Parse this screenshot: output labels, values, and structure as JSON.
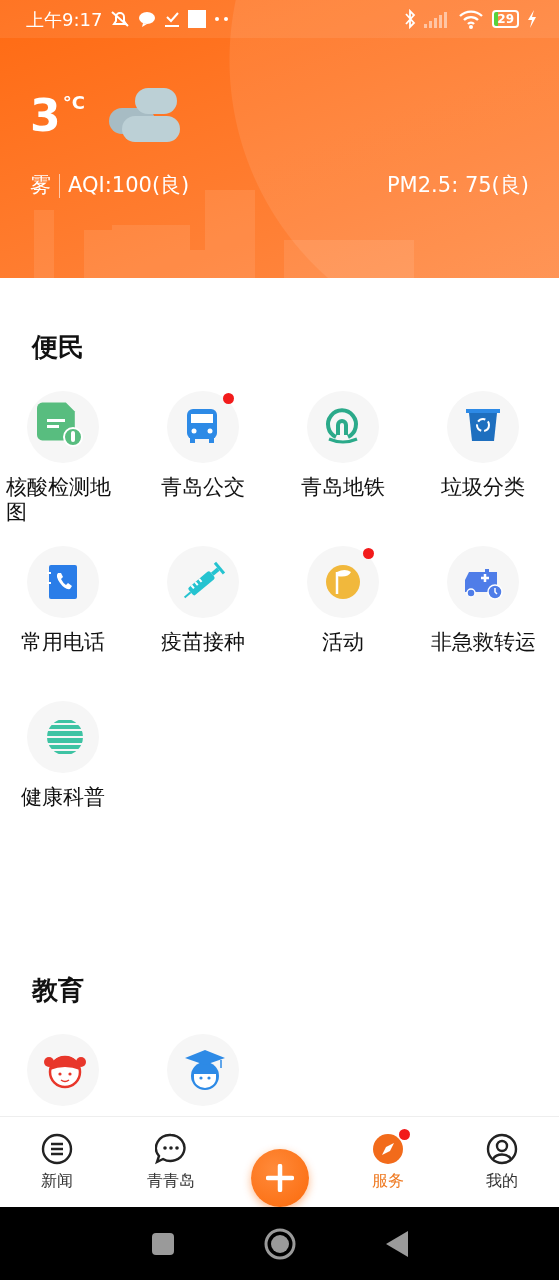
{
  "status_bar": {
    "time": "上午9:17",
    "battery": "29"
  },
  "weather": {
    "temperature": "3",
    "unit": "°C",
    "condition": "雾",
    "aqi": "AQI:100(良)",
    "pm25": "PM2.5: 75(良)"
  },
  "sections": [
    {
      "title": "便民",
      "items": [
        {
          "label": "核酸检测地图",
          "badge": false
        },
        {
          "label": "青岛公交",
          "badge": true
        },
        {
          "label": "青岛地铁",
          "badge": false
        },
        {
          "label": "垃圾分类",
          "badge": false
        },
        {
          "label": "常用电话",
          "badge": false
        },
        {
          "label": "疫苗接种",
          "badge": false
        },
        {
          "label": "活动",
          "badge": true
        },
        {
          "label": "非急救转运",
          "badge": false
        },
        {
          "label": "健康科普",
          "badge": false
        }
      ]
    },
    {
      "title": "教育",
      "items": [
        {
          "badge": false
        },
        {
          "badge": false
        }
      ]
    }
  ],
  "bottom_nav": [
    {
      "kind": "tab",
      "label": "新闻",
      "selected": false,
      "badge": false
    },
    {
      "kind": "tab",
      "label": "青青岛",
      "selected": false,
      "badge": false
    },
    {
      "kind": "add"
    },
    {
      "kind": "tab",
      "label": "服务",
      "selected": true,
      "badge": true
    },
    {
      "kind": "tab",
      "label": "我的",
      "selected": false,
      "badge": false
    }
  ]
}
